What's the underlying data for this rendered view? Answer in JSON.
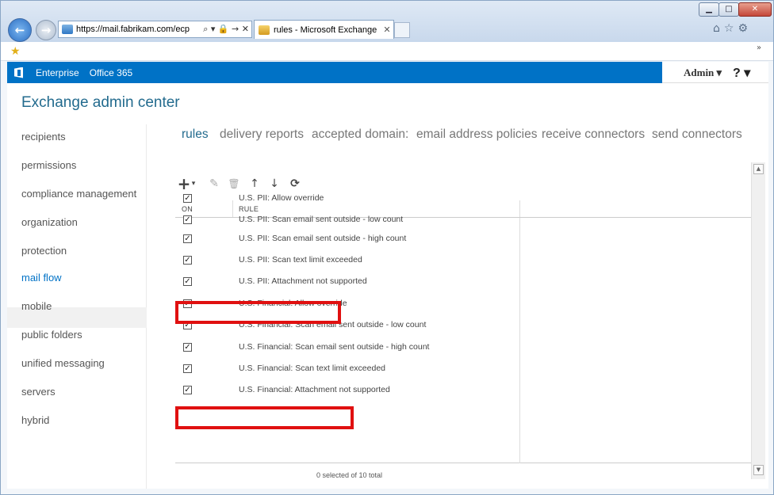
{
  "browser": {
    "window_controls": {
      "minimize": "▁",
      "maximize": "□",
      "close": "✕"
    },
    "back_glyph": "←",
    "forward_glyph": "→",
    "address_url": "https://mail.fabrikam.com/ecp",
    "address_tools": "⌕ ▾ 🔒 → ✕",
    "tab_title": "rules - Microsoft Exchange",
    "tab_close": "✕",
    "tool_icons": "⌂☆⚙",
    "fav_more": "»"
  },
  "header": {
    "links": [
      "Enterprise",
      "Office 365"
    ],
    "admin_label": "Admin ▾",
    "help_label": "? ▾"
  },
  "app": {
    "title": "Exchange admin center"
  },
  "nav": {
    "items": [
      "recipients",
      "permissions",
      "compliance management",
      "organization",
      "protection",
      "mail flow",
      "mobile",
      "public folders",
      "unified messaging",
      "servers",
      "hybrid"
    ],
    "selected_index": 5
  },
  "subtabs": [
    "rules",
    "delivery reports",
    "accepted domain:",
    "email address policies",
    "receive connectors",
    "send connectors"
  ],
  "toolbar": {
    "add": "+",
    "add_dropdown": "▾",
    "edit": "✎",
    "delete": "🗑",
    "move_up": "↑",
    "move_down": "↓",
    "refresh": "⟳"
  },
  "grid": {
    "columns": [
      "ON",
      "RULE"
    ],
    "check_glyph": "✓",
    "rows": [
      {
        "on": true,
        "rule": "U.S. PII: Allow override",
        "highlighted": true
      },
      {
        "on": true,
        "rule": "U.S. PII: Scan email sent outside - low count",
        "highlighted": false
      },
      {
        "on": true,
        "rule": "U.S. PII: Scan email sent outside - high count",
        "highlighted": false
      },
      {
        "on": true,
        "rule": "U.S. PII: Scan text limit exceeded",
        "highlighted": false
      },
      {
        "on": true,
        "rule": "U.S. PII: Attachment not supported",
        "highlighted": false
      },
      {
        "on": true,
        "rule": "U.S. Financial: Allow override",
        "highlighted": true
      },
      {
        "on": true,
        "rule": "U.S. Financial: Scan email sent outside - low count",
        "highlighted": false
      },
      {
        "on": true,
        "rule": "U.S. Financial: Scan email sent outside - high count",
        "highlighted": false
      },
      {
        "on": true,
        "rule": "U.S. Financial: Scan text limit exceeded",
        "highlighted": false
      },
      {
        "on": true,
        "rule": "U.S. Financial: Attachment not supported",
        "highlighted": false
      }
    ],
    "status": "0 selected of 10 total"
  },
  "scrollbar": {
    "up": "▲",
    "down": "▼"
  },
  "colors": {
    "o365_blue": "#0072c6",
    "title_teal": "#236b8e",
    "highlight_red": "#e01010"
  }
}
